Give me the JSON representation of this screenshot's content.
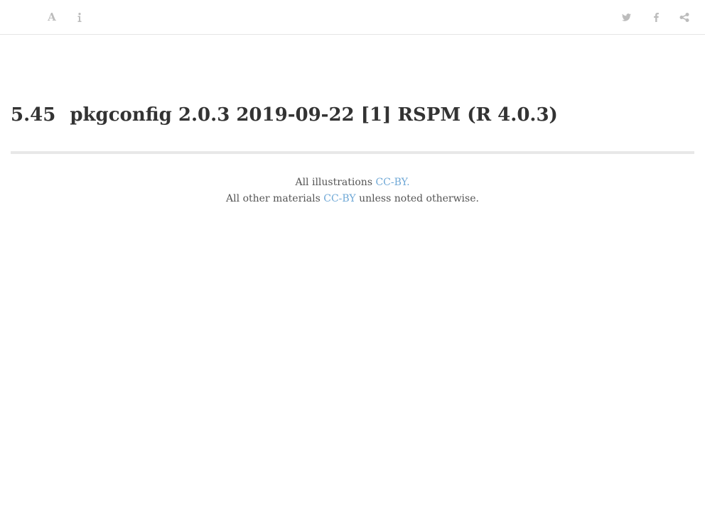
{
  "toolbar": {
    "font_label": "A",
    "icons": {
      "font": "font-settings-icon",
      "info": "info-icon",
      "twitter": "twitter-icon",
      "facebook": "facebook-icon",
      "share": "share-icon"
    }
  },
  "heading": {
    "number": "5.45",
    "text": "pkgconfig 2.0.3 2019-09-22 [1] RSPM (R 4.0.3)"
  },
  "footer": {
    "line1_prefix": "All illustrations ",
    "line1_link": "CC-BY.",
    "line2_prefix": "All other materials ",
    "line2_link": "CC-BY",
    "line2_suffix": " unless noted otherwise."
  },
  "colors": {
    "link": "#6fa8d6",
    "icon": "#bcbcbc",
    "text": "#333333"
  }
}
